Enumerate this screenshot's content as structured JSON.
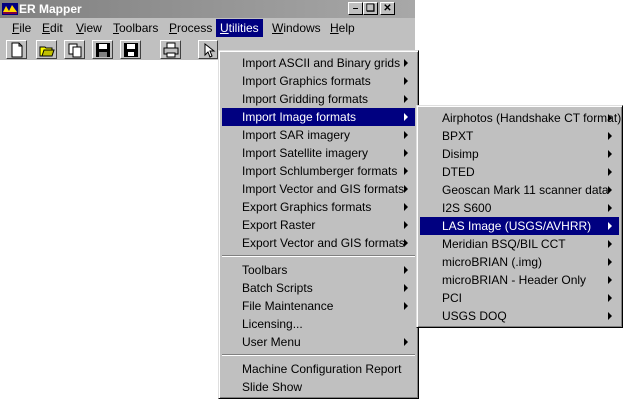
{
  "window": {
    "title": "ER Mapper"
  },
  "menubar": [
    {
      "label": "File",
      "mnemonic": "F",
      "rest": "ile"
    },
    {
      "label": "Edit",
      "mnemonic": "E",
      "rest": "dit"
    },
    {
      "label": "View",
      "mnemonic": "V",
      "rest": "iew"
    },
    {
      "label": "Toolbars",
      "mnemonic": "T",
      "rest": "oolbars"
    },
    {
      "label": "Process",
      "mnemonic": "P",
      "rest": "rocess"
    },
    {
      "label": "Utilities",
      "mnemonic": "U",
      "rest": "tilities"
    },
    {
      "label": "Windows",
      "mnemonic": "W",
      "rest": "indows"
    },
    {
      "label": "Help",
      "mnemonic": "H",
      "rest": "elp"
    }
  ],
  "toolbar": {
    "icons": [
      "new-icon",
      "open-icon",
      "copy-icon",
      "save-icon",
      "save-as-icon",
      "print-icon",
      "pointer-icon"
    ]
  },
  "utilities_menu": {
    "items": [
      "Import ASCII and Binary grids",
      "Import Graphics formats",
      "Import Gridding formats",
      "Import Image formats",
      "Import SAR imagery",
      "Import Satellite imagery",
      "Import Schlumberger formats",
      "Import Vector and GIS formats",
      "Export Graphics formats",
      "Export Raster",
      "Export Vector and GIS formats",
      "Toolbars",
      "Batch Scripts",
      "File Maintenance",
      "Licensing...",
      "User Menu",
      "Machine Configuration Report",
      "Slide Show"
    ],
    "highlighted": "Import Image formats"
  },
  "image_formats_menu": {
    "items": [
      "Airphotos (Handshake CT format)",
      "BPXT",
      "Disimp",
      "DTED",
      "Geoscan Mark 11 scanner data",
      "I2S S600",
      "LAS Image (USGS/AVHRR)",
      "Meridian BSQ/BIL CCT",
      "microBRIAN (.img)",
      "microBRIAN - Header Only",
      "PCI",
      "USGS DOQ"
    ],
    "highlighted": "LAS Image (USGS/AVHRR)"
  },
  "colors": {
    "highlight": "#000080",
    "face": "#c0c0c0"
  }
}
